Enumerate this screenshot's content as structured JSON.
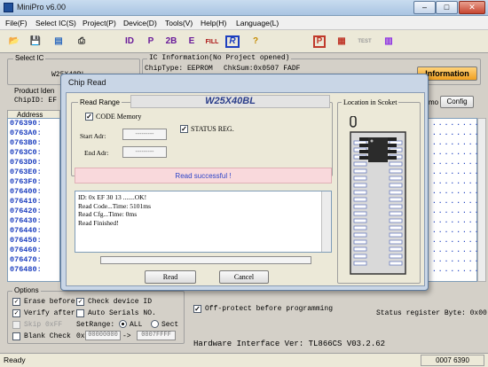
{
  "window": {
    "title": "MiniPro v6.00",
    "minimize": "–",
    "maximize": "□",
    "close": "✕"
  },
  "menu": [
    "File(F)",
    "Select IC(S)",
    "Project(P)",
    "Device(D)",
    "Tools(V)",
    "Help(H)",
    "Language(L)"
  ],
  "toolbar": {
    "icons": [
      "open-icon",
      "save-icon",
      "device-info-icon",
      "print-icon",
      "id-icon",
      "program-icon",
      "blank-check-icon",
      "erase-icon",
      "fill-icon",
      "read-icon",
      "help-icon",
      "protect-icon",
      "config-icon",
      "test-icon",
      "chip-icon"
    ],
    "glyphs": [
      "📂",
      "💾",
      "▤",
      "⎙",
      "ID",
      "P",
      "2B",
      "E",
      "FILL",
      "R",
      "?",
      "P",
      "▦",
      "TEST",
      "▥"
    ],
    "test_label": "TEST"
  },
  "select_ic": {
    "label": "Select IC",
    "value": "W25X40BL"
  },
  "ic_info": {
    "label": "IC Information(No Project opened)",
    "chip_type": "ChipType: EEPROM",
    "checksum": "ChkSum:0x0507 FADF",
    "information_btn": "Information"
  },
  "product_ident": {
    "label": "Product Iden",
    "chip_id": "ChipID: EF 3"
  },
  "config_btn": "Config",
  "demo_label": "mo",
  "address": {
    "header": "Address",
    "rows": [
      "076390:",
      "0763A0:",
      "0763B0:",
      "0763C0:",
      "0763D0:",
      "0763E0:",
      "0763F0:",
      "076400:",
      "076410:",
      "076420:",
      "076430:",
      "076440:",
      "076450:",
      "076460:",
      "076470:",
      "076480:"
    ]
  },
  "dialog": {
    "title": "Chip Read",
    "read_range_label": "Read Range",
    "chip_name": "W25X40BL",
    "code_memory": "CODE Memory",
    "status_reg": "STATUS REG.",
    "start_adr_label": "Start Adr:",
    "start_adr_value": "---------",
    "end_adr_label": "End Adr:",
    "end_adr_value": "---------",
    "status_message": "Read successful !",
    "log_lines": [
      "ID: 0x EF 30 13 .......OK!",
      "Read Code...Time: 5101ms",
      "Read Cfg...Time: 0ms",
      "Read Finished!"
    ],
    "location_label": "Location in Scoket",
    "read_btn": "Read",
    "cancel_btn": "Cancel"
  },
  "options": {
    "label": "Options",
    "erase_before": "Erase before",
    "check_device_id": "Check device ID",
    "verify_after": "Verify after",
    "auto_serials": "Auto Serials NO.",
    "skip_0xff": "Skip 0xFF",
    "set_range": "SetRange:",
    "all": "ALL",
    "sect": "Sect",
    "blank_check": "Blank Check",
    "range_prefix": "0x",
    "range_start": "00000000",
    "range_arrow": "->",
    "range_end": "0007FFFF"
  },
  "off_protect": "Off-protect before programming",
  "status_register": "Status register Byte: 0x00",
  "hardware_interface": "Hardware Interface Ver: TL866CS V03.2.62",
  "statusbar": {
    "left": "Ready",
    "right": "0007 6390"
  }
}
